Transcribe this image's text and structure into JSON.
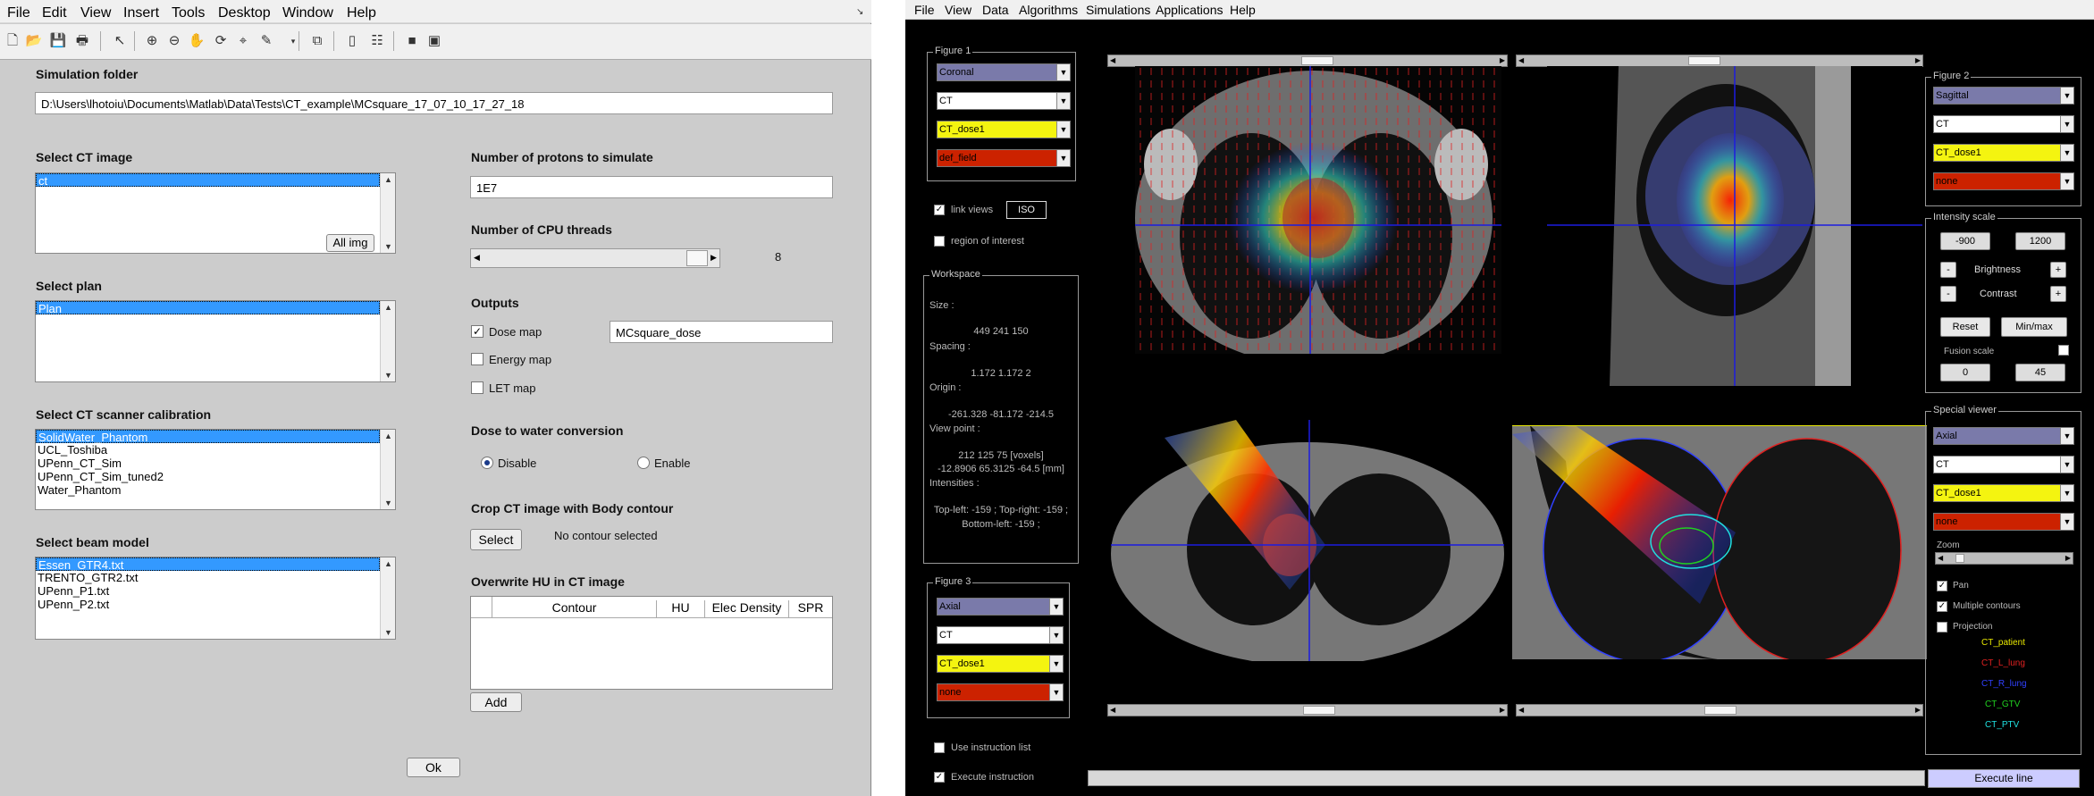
{
  "left_window": {
    "menu": [
      "File",
      "Edit",
      "View",
      "Insert",
      "Tools",
      "Desktop",
      "Window",
      "Help"
    ],
    "simulation_folder": {
      "label": "Simulation folder",
      "value": "D:\\Users\\lhotoiu\\Documents\\Matlab\\Data\\Tests\\CT_example\\MCsquare_17_07_10_17_27_18"
    },
    "ct_image": {
      "label": "Select CT image",
      "items": [
        "ct"
      ],
      "all_img_label": "All img"
    },
    "plan": {
      "label": "Select plan",
      "items": [
        "Plan"
      ]
    },
    "calibration": {
      "label": "Select CT scanner calibration",
      "items": [
        "SolidWater_Phantom",
        "UCL_Toshiba",
        "UPenn_CT_Sim",
        "UPenn_CT_Sim_tuned2",
        "Water_Phantom"
      ]
    },
    "beam_model": {
      "label": "Select beam model",
      "items": [
        "Essen_GTR4.txt",
        "TRENTO_GTR2.txt",
        "UPenn_P1.txt",
        "UPenn_P2.txt"
      ]
    },
    "protons": {
      "label": "Number of protons to simulate",
      "value": "1E7"
    },
    "cpu": {
      "label": "Number of CPU threads",
      "value": "8"
    },
    "outputs": {
      "label": "Outputs",
      "dose": {
        "label": "Dose map",
        "checked": true,
        "name": "MCsquare_dose"
      },
      "energy": {
        "label": "Energy map",
        "checked": false
      },
      "let": {
        "label": "LET map",
        "checked": false
      }
    },
    "dose_to_water": {
      "label": "Dose to water conversion",
      "disable": "Disable",
      "enable": "Enable",
      "selected": "Disable"
    },
    "crop": {
      "label": "Crop CT image with Body contour",
      "button": "Select",
      "status": "No contour selected"
    },
    "overwrite": {
      "label": "Overwrite HU in CT image",
      "columns": [
        "",
        "Contour",
        "HU",
        "Elec Density",
        "SPR"
      ],
      "add_label": "Add"
    },
    "ok_label": "Ok"
  },
  "right_window": {
    "menu": [
      "File",
      "View",
      "Data",
      "Algorithms",
      "Simulations",
      "Applications",
      "Help"
    ],
    "figure1": {
      "title": "Figure 1",
      "view": "Coronal",
      "image": "CT",
      "fusion": "CT_dose1",
      "overlay": "def_field"
    },
    "link_views": "link views",
    "iso_label": "ISO",
    "roi_label": "region of interest",
    "workspace": {
      "title": "Workspace",
      "size_label": "Size :",
      "size": "449  241  150",
      "spacing_label": "Spacing :",
      "spacing": "1.172  1.172  2",
      "origin_label": "Origin :",
      "origin": "-261.328  -81.172  -214.5",
      "viewpoint_label": "View point :",
      "viewpoint_vox": "212  125  75 [voxels]",
      "viewpoint_mm": "-12.8906  65.3125  -64.5 [mm]",
      "intensities_label": "Intensities :",
      "intensities_1": "Top-left: -159 ; Top-right: -159 ;",
      "intensities_2": "Bottom-left: -159 ;"
    },
    "figure3": {
      "title": "Figure 3",
      "view": "Axial",
      "image": "CT",
      "fusion": "CT_dose1",
      "overlay": "none"
    },
    "figure2": {
      "title": "Figure 2",
      "view": "Sagittal",
      "image": "CT",
      "fusion": "CT_dose1",
      "overlay": "none"
    },
    "intensity_scale": {
      "title": "Intensity scale",
      "min": "-900",
      "max": "1200",
      "brightness": "Brightness",
      "contrast": "Contrast",
      "reset": "Reset",
      "minmax": "Min/max",
      "fusion_scale": "Fusion scale",
      "fmin": "0",
      "fmax": "45"
    },
    "special_viewer": {
      "title": "Special viewer",
      "view": "Axial",
      "image": "CT",
      "fusion": "CT_dose1",
      "overlay": "none",
      "zoom": "Zoom",
      "pan": "Pan",
      "multiple_contours": "Multiple contours",
      "projection": "Projection",
      "contours": [
        {
          "name": "CT_patient",
          "color": "#e8e800"
        },
        {
          "name": "CT_L_lung",
          "color": "#e02020"
        },
        {
          "name": "CT_R_lung",
          "color": "#3040ff"
        },
        {
          "name": "CT_GTV",
          "color": "#20d020"
        },
        {
          "name": "CT_PTV",
          "color": "#20e0e0"
        }
      ]
    },
    "use_instruction_list": "Use instruction list",
    "execute_instruction": "Execute instruction",
    "execute_line": "Execute line"
  }
}
